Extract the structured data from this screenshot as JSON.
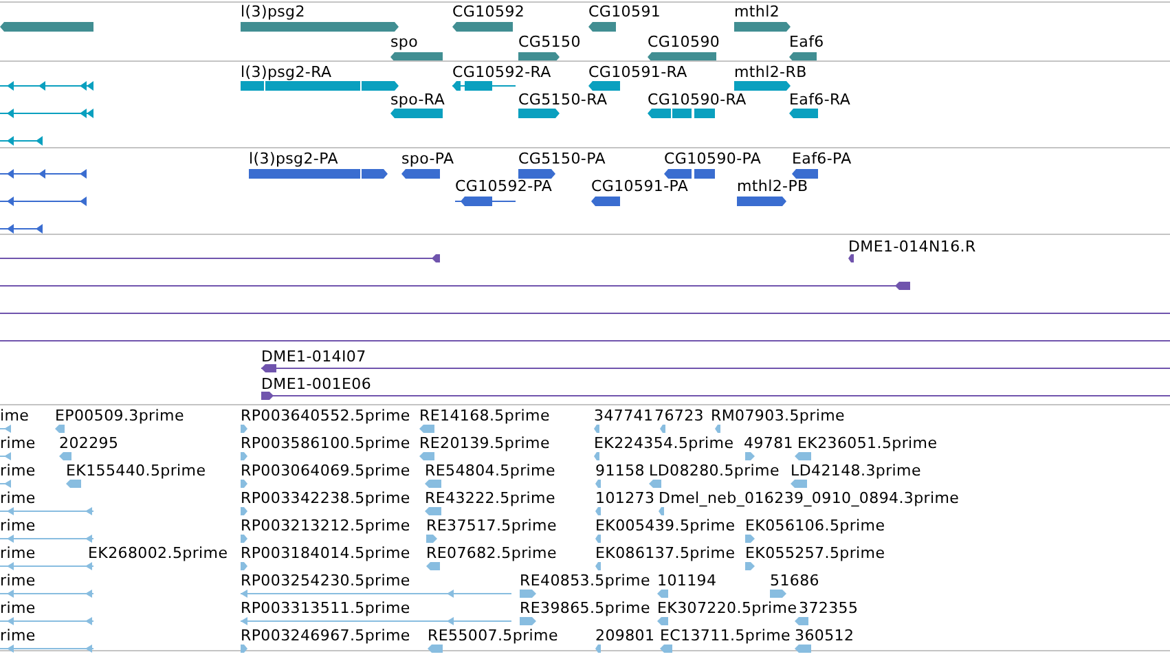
{
  "tracks": [
    {
      "kind": "gene",
      "rows": [
        [
          {
            "reverse": true
          },
          {
            "label": "l(3)psg2",
            "reverse": false
          },
          {
            "label": "CG10592",
            "reverse": true
          },
          {
            "label": "CG10591",
            "reverse": true
          },
          {
            "label": "mthl2",
            "reverse": false
          }
        ],
        [
          {
            "label": "spo",
            "reverse": true
          },
          {
            "label": "CG5150",
            "reverse": false
          },
          {
            "label": "CG10590",
            "reverse": true
          },
          {
            "label": "Eaf6",
            "reverse": true
          }
        ]
      ]
    },
    {
      "kind": "transcript",
      "rows": [
        [
          {
            "reverse": true
          },
          {
            "label": "l(3)psg2-RA",
            "reverse": false
          },
          {
            "label": "CG10592-RA",
            "reverse": true
          },
          {
            "label": "CG10591-RA",
            "reverse": true
          },
          {
            "label": "mthl2-RB",
            "reverse": false
          }
        ],
        [
          {
            "reverse": true
          },
          {
            "label": "spo-RA",
            "reverse": true
          },
          {
            "label": "CG5150-RA",
            "reverse": false
          },
          {
            "label": "CG10590-RA",
            "reverse": true
          },
          {
            "label": "Eaf6-RA",
            "reverse": true
          }
        ],
        [
          {
            "reverse": true
          }
        ]
      ]
    },
    {
      "kind": "protein",
      "rows": [
        [
          {
            "reverse": true
          },
          {
            "label": "l(3)psg2-PA",
            "reverse": false
          },
          {
            "label": "spo-PA",
            "reverse": true
          },
          {
            "label": "CG5150-PA",
            "reverse": false
          },
          {
            "label": "CG10590-PA",
            "reverse": true
          },
          {
            "label": "Eaf6-PA",
            "reverse": true
          }
        ],
        [
          {
            "reverse": true
          },
          {
            "label": "CG10592-PA",
            "reverse": true
          },
          {
            "label": "CG10591-PA",
            "reverse": true
          },
          {
            "label": "mthl2-PB",
            "reverse": false
          }
        ],
        [
          {
            "reverse": true
          }
        ]
      ]
    },
    {
      "kind": "clone",
      "rows": [
        [
          {
            "reverse": true
          },
          {
            "label": "DME1-014N16.R",
            "reverse": true
          }
        ],
        [
          {
            "reverse": true
          }
        ],
        [
          {}
        ],
        [
          {}
        ],
        [
          {
            "label": "DME1-014I07",
            "reverse": true
          }
        ],
        [
          {
            "label": "DME1-001E06",
            "reverse": false
          }
        ]
      ]
    },
    {
      "kind": "est",
      "rows": [
        [
          {
            "label": "ime",
            "reverse": true
          },
          {
            "label": "EP00509.3prime",
            "reverse": true
          },
          {
            "label": "RP003640552.5prime",
            "reverse": false
          },
          {
            "label": "RE14168.5prime",
            "reverse": true
          },
          {
            "label": "347741",
            "reverse": true
          },
          {
            "label": "76723",
            "reverse": true
          },
          {
            "label": "RM07903.5prime",
            "reverse": true
          }
        ],
        [
          {
            "label": "rime",
            "reverse": true
          },
          {
            "label": "202295",
            "reverse": true
          },
          {
            "label": "RP003586100.5prime",
            "reverse": false
          },
          {
            "label": "RE20139.5prime",
            "reverse": true
          },
          {
            "label": "EK224354.5prime",
            "reverse": true
          },
          {
            "label": "49781",
            "reverse": false
          },
          {
            "label": "EK236051.5prime",
            "reverse": true
          }
        ],
        [
          {
            "label": "rime",
            "reverse": true
          },
          {
            "label": "EK155440.5prime",
            "reverse": true
          },
          {
            "label": "RP003064069.5prime",
            "reverse": false
          },
          {
            "label": "RE54804.5prime",
            "reverse": true
          },
          {
            "label": "91158",
            "reverse": true
          },
          {
            "label": "LD08280.5prime",
            "reverse": true
          },
          {
            "label": "LD42148.3prime",
            "reverse": true
          }
        ],
        [
          {
            "label": "rime",
            "reverse": true
          },
          {
            "label": "RP003342238.5prime",
            "reverse": false
          },
          {
            "label": "RE43222.5prime",
            "reverse": true
          },
          {
            "label": "101273",
            "reverse": true
          },
          {
            "label": "Dmel_neb_016239_0910_0894.3prime",
            "reverse": true
          }
        ],
        [
          {
            "label": "rime",
            "reverse": true
          },
          {
            "label": "RP003213212.5prime",
            "reverse": false
          },
          {
            "label": "RE37517.5prime",
            "reverse": false
          },
          {
            "label": "EK005439.5prime",
            "reverse": true
          },
          {
            "label": "EK056106.5prime",
            "reverse": false
          }
        ],
        [
          {
            "label": "rime",
            "reverse": true
          },
          {
            "label": "EK268002.5prime"
          },
          {
            "label": "RP003184014.5prime",
            "reverse": false
          },
          {
            "label": "RE07682.5prime",
            "reverse": true
          },
          {
            "label": "EK086137.5prime",
            "reverse": true
          },
          {
            "label": "EK055257.5prime",
            "reverse": false
          }
        ],
        [
          {
            "label": "rime",
            "reverse": true
          },
          {
            "label": "RP003254230.5prime",
            "reverse": true
          },
          {
            "label": "RE40853.5prime",
            "reverse": false
          },
          {
            "label": "101194",
            "reverse": true
          },
          {
            "label": "51686",
            "reverse": false
          }
        ],
        [
          {
            "label": "rime",
            "reverse": true
          },
          {
            "label": "RP003313511.5prime",
            "reverse": true
          },
          {
            "label": "RE39865.5prime",
            "reverse": false
          },
          {
            "label": "EK307220.5prime",
            "reverse": true
          },
          {
            "label": "372355",
            "reverse": true
          }
        ],
        [
          {
            "label": "rime",
            "reverse": true
          },
          {
            "label": "RP003246967.5prime",
            "reverse": false
          },
          {
            "label": "RE55007.5prime",
            "reverse": true
          },
          {
            "label": "209801",
            "reverse": true
          },
          {
            "label": "EC13711.5prime",
            "reverse": true
          },
          {
            "label": "360512",
            "reverse": true
          }
        ]
      ]
    }
  ]
}
